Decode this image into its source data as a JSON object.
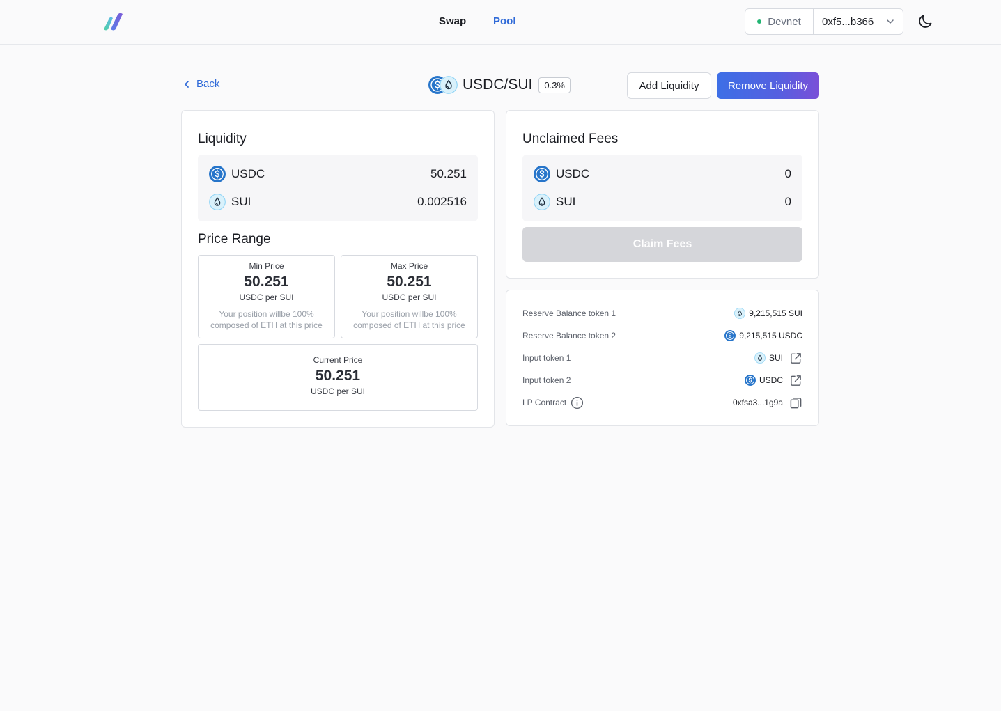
{
  "header": {
    "nav": {
      "swap": "Swap",
      "pool": "Pool"
    },
    "network": "Devnet",
    "wallet": "0xf5...b366"
  },
  "subheader": {
    "back": "Back",
    "pair": "USDC/SUI",
    "fee": "0.3%",
    "add_liquidity": "Add Liquidity",
    "remove_liquidity": "Remove Liquidity"
  },
  "liquidity": {
    "title": "Liquidity",
    "tokens": [
      {
        "symbol": "USDC",
        "amount": "50.251",
        "icon": "usdc-icon"
      },
      {
        "symbol": "SUI",
        "amount": "0.002516",
        "icon": "sui-icon"
      }
    ]
  },
  "price_range": {
    "title": "Price Range",
    "min": {
      "label": "Min Price",
      "value": "50.251",
      "unit": "USDC per SUI",
      "note_line1": "Your position willbe 100%",
      "note_line2": "composed of ETH at this price"
    },
    "max": {
      "label": "Max Price",
      "value": "50.251",
      "unit": "USDC per SUI",
      "note_line1": "Your position willbe 100%",
      "note_line2": "composed of ETH at this price"
    },
    "current": {
      "label": "Current Price",
      "value": "50.251",
      "unit": "USDC per SUI"
    }
  },
  "fees": {
    "title": "Unclaimed Fees",
    "tokens": [
      {
        "symbol": "USDC",
        "amount": "0",
        "icon": "usdc-icon"
      },
      {
        "symbol": "SUI",
        "amount": "0",
        "icon": "sui-icon"
      }
    ],
    "claim": "Claim Fees"
  },
  "info": {
    "reserve1_label": "Reserve Balance token 1",
    "reserve1_value": "9,215,515 SUI",
    "reserve2_label": "Reserve Balance token 2",
    "reserve2_value": "9,215,515 USDC",
    "input1_label": "Input token 1",
    "input1_value": "SUI",
    "input2_label": "Input token 2",
    "input2_value": "USDC",
    "lp_label": "LP Contract",
    "lp_value": "0xfsa3...1g9a"
  },
  "colors": {
    "accent": "#2f6ad8",
    "usdc": "#2775ca",
    "sui": "#4ca3ff",
    "status_dot": "#22b573",
    "gradient_start": "#3d6fe6",
    "gradient_end": "#7a4fd8"
  }
}
